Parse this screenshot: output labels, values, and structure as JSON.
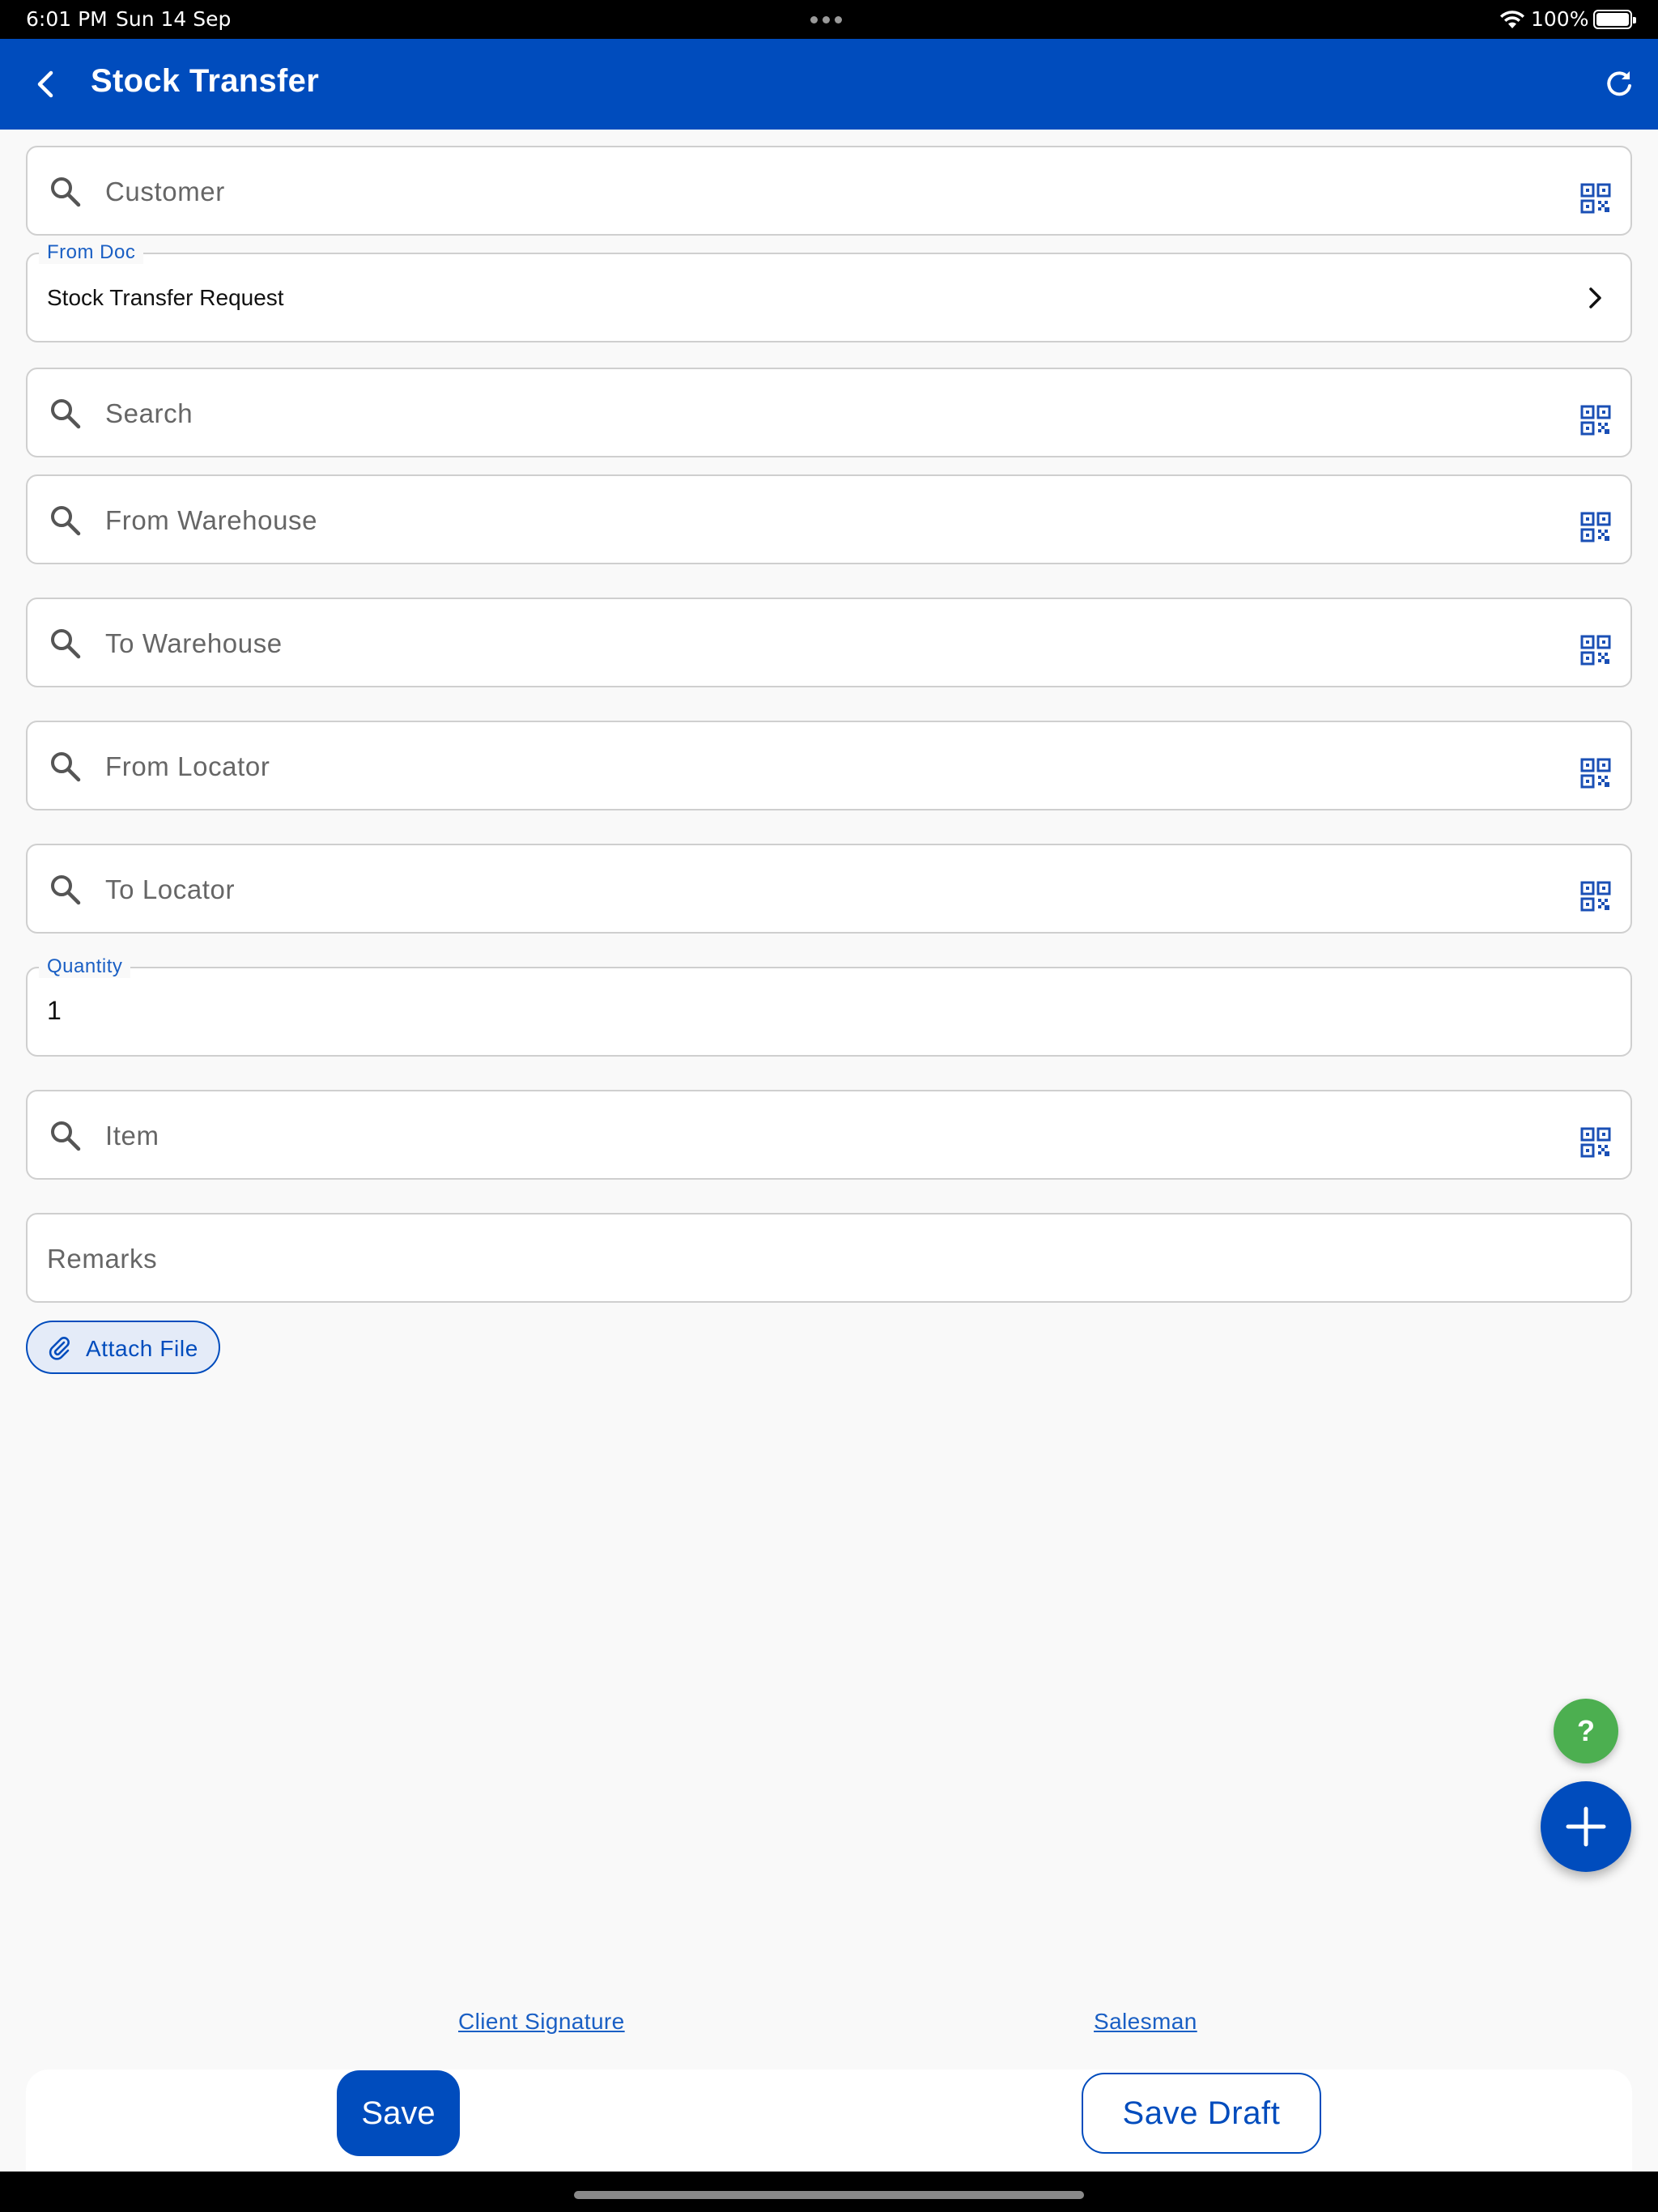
{
  "status_bar": {
    "time": "6:01 PM",
    "date": "Sun 14 Sep",
    "battery": "100%"
  },
  "app_bar": {
    "title": "Stock Transfer"
  },
  "form": {
    "customer_placeholder": "Customer",
    "from_doc_label": "From Doc",
    "from_doc_value": "Stock Transfer Request",
    "search_placeholder": "Search",
    "from_warehouse_placeholder": "From Warehouse",
    "to_warehouse_placeholder": "To Warehouse",
    "from_locator_placeholder": "From Locator",
    "to_locator_placeholder": "To Locator",
    "quantity_label": "Quantity",
    "quantity_value": "1",
    "item_placeholder": "Item",
    "remarks_placeholder": "Remarks",
    "attach_label": "Attach File"
  },
  "fab": {
    "help_label": "?"
  },
  "footer": {
    "client_signature": "Client Signature",
    "salesman": "Salesman",
    "save_label": "Save",
    "save_draft_label": "Save Draft"
  },
  "colors": {
    "primary": "#004cbd",
    "help_green": "#4caf50",
    "background": "#f9f9f9"
  },
  "icons": [
    "back-arrow-icon",
    "refresh-icon",
    "search-icon",
    "qr-code-icon",
    "chevron-right-icon",
    "paperclip-icon",
    "plus-icon"
  ]
}
